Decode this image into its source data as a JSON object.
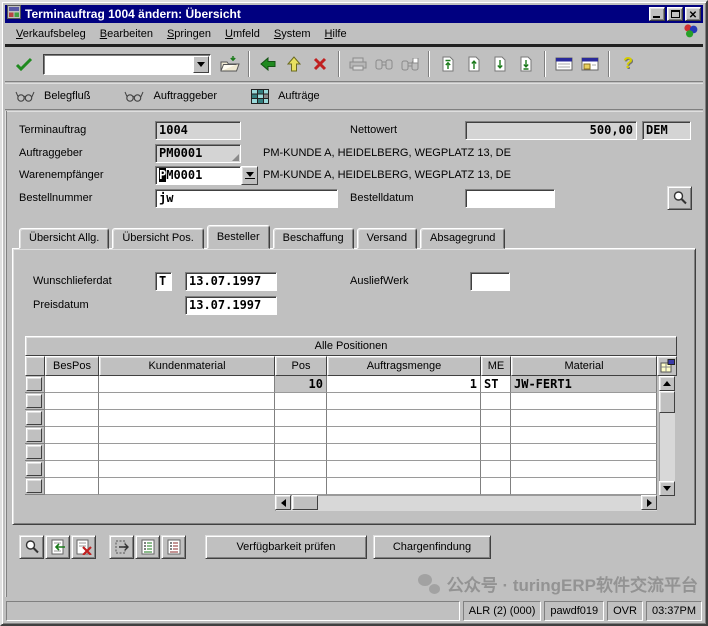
{
  "window": {
    "title": "Terminauftrag 1004 ändern: Übersicht"
  },
  "menu": {
    "items": [
      "Verkaufsbeleg",
      "Bearbeiten",
      "Springen",
      "Umfeld",
      "System",
      "Hilfe"
    ]
  },
  "toolbar": {
    "command_value": ""
  },
  "app_toolbar": {
    "belegfluss": "Belegfluß",
    "auftraggeber": "Auftraggeber",
    "auftraege": "Aufträge"
  },
  "form": {
    "terminauftrag_label": "Terminauftrag",
    "terminauftrag_value": "1004",
    "nettowert_label": "Nettowert",
    "nettowert_value": "500,00",
    "currency": "DEM",
    "auftraggeber_label": "Auftraggeber",
    "auftraggeber_value": "PM0001",
    "auftraggeber_info": "PM-KUNDE A, HEIDELBERG, WEGPLATZ 13, DE",
    "warenempfaenger_label": "Warenempfänger",
    "warenempfaenger_value_sel": "P",
    "warenempfaenger_value_rest": "M0001",
    "warenempfaenger_info": "PM-KUNDE A, HEIDELBERG, WEGPLATZ 13, DE",
    "bestellnummer_label": "Bestellnummer",
    "bestellnummer_value": "jw",
    "bestelldatum_label": "Bestelldatum",
    "bestelldatum_value": ""
  },
  "tabs": {
    "items": [
      "Übersicht Allg.",
      "Übersicht Pos.",
      "Besteller",
      "Beschaffung",
      "Versand",
      "Absagegrund"
    ],
    "active": "Besteller"
  },
  "tab_panel": {
    "wunschlieferdat_label": "Wunschlieferdat",
    "wunschlieferdat_type": "T",
    "wunschlieferdat_date": "13.07.1997",
    "ausliefwerk_label": "AusliefWerk",
    "ausliefwerk_value": "",
    "preisdatum_label": "Preisdatum",
    "preisdatum_date": "13.07.1997"
  },
  "positions_table": {
    "title": "Alle Positionen",
    "columns": [
      "BesPos",
      "Kundenmaterial",
      "Pos",
      "Auftragsmenge",
      "ME",
      "Material"
    ],
    "row": {
      "bespos": "",
      "kundenmaterial": "",
      "pos": "10",
      "auftragsmenge": "1",
      "me": "ST",
      "material": "JW-FERT1"
    },
    "empty_row_count": 6
  },
  "actions": {
    "verfuegbarkeit": "Verfügbarkeit prüfen",
    "chargenfindung": "Chargenfindung"
  },
  "status_bar": {
    "system": "ALR (2) (000)",
    "host": "pawdf019",
    "mode": "OVR",
    "time": "03:37PM"
  },
  "watermark": {
    "text": "公众号 · turingERP软件交流平台"
  },
  "colors": {
    "titlebar": "#000080",
    "chrome": "#c0c0c0",
    "accent_green": "#1f8a1f",
    "accent_red": "#c02020"
  }
}
